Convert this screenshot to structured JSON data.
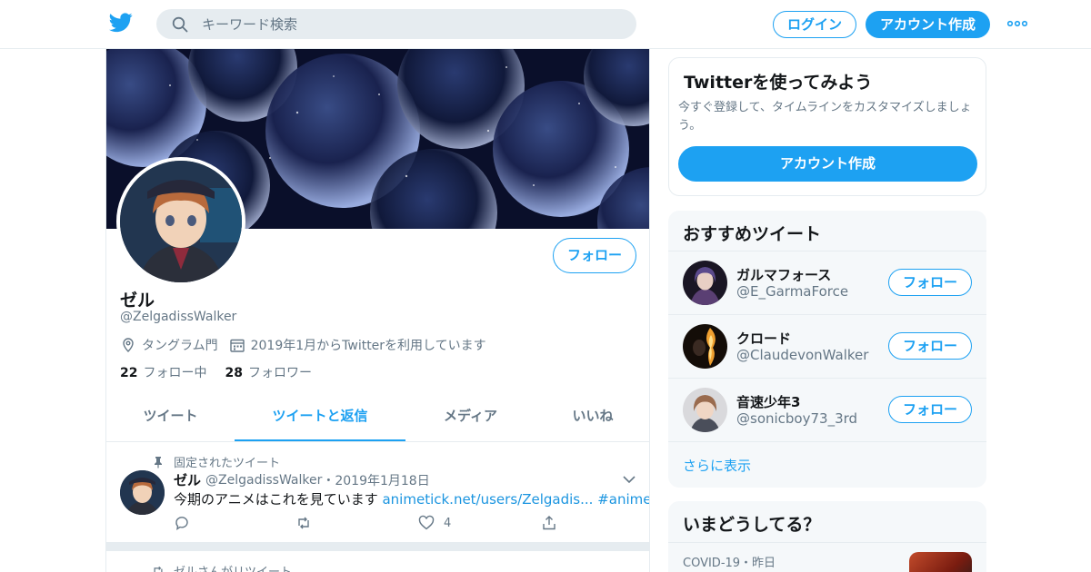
{
  "topbar": {
    "search_placeholder": "キーワード検索",
    "login_label": "ログイン",
    "signup_label": "アカウント作成"
  },
  "profile": {
    "follow_label": "フォロー",
    "name": "ゼル",
    "handle": "@ZelgadissWalker",
    "location": "タングラム門",
    "joined": "2019年1月からTwitterを利用しています",
    "following_count": "22",
    "following_label": "フォロー中",
    "followers_count": "28",
    "followers_label": "フォロワー"
  },
  "tabs": [
    {
      "label": "ツイート",
      "active": false
    },
    {
      "label": "ツイートと返信",
      "active": true
    },
    {
      "label": "メディア",
      "active": false
    },
    {
      "label": "いいね",
      "active": false
    }
  ],
  "pinned_tweet": {
    "pinned_label": "固定されたツイート",
    "author_name": "ゼル",
    "author_handle": "@ZelgadissWalker",
    "separator": "・",
    "date": "2019年1月18日",
    "text": "今期のアニメはこれを見ています",
    "link_text": "animetick.net/users/Zelgadis...",
    "hashtag": "#animetick",
    "like_count": "4"
  },
  "retweet_line": {
    "label": "ゼルさんがリツイート"
  },
  "signup_card": {
    "title": "Twitterを使ってみよう",
    "description": "今すぐ登録して、タイムラインをカスタマイズしましょう。",
    "button_label": "アカウント作成"
  },
  "recommendations": {
    "title": "おすすめツイート",
    "follow_label": "フォロー",
    "items": [
      {
        "name": "ガルマフォース",
        "handle": "@E_GarmaForce"
      },
      {
        "name": "クロード",
        "handle": "@ClaudevonWalker"
      },
      {
        "name": "音速少年3",
        "handle": "@sonicboy73_3rd"
      }
    ],
    "show_more": "さらに表示"
  },
  "trends": {
    "title": "いまどうしてる？",
    "first_context": "COVID-19・昨日"
  },
  "colors": {
    "accent": "#1da1f2",
    "link": "#1b95e0",
    "muted": "#657786",
    "border": "#e6ecf0",
    "panel": "#f5f8fa"
  }
}
